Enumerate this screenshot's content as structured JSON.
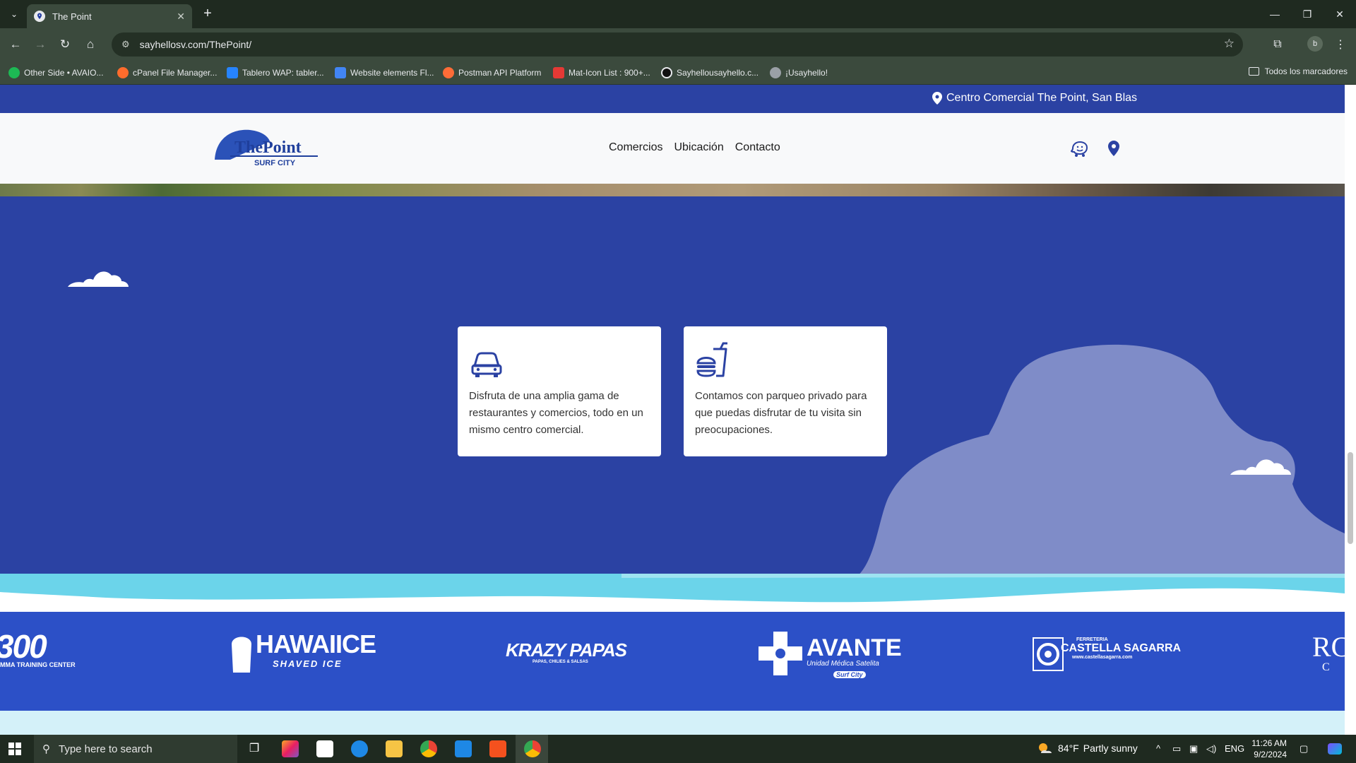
{
  "browser": {
    "tab_title": "The Point",
    "url": "sayhellosv.com/ThePoint/",
    "bookmarks": [
      {
        "label": "Other Side • AVAIO...",
        "color": "#1db954"
      },
      {
        "label": "cPanel File Manager...",
        "color": "#ff6c2c"
      },
      {
        "label": "Tablero WAP: tabler...",
        "color": "#2684ff"
      },
      {
        "label": "Website elements Fl...",
        "color": "#4285f4"
      },
      {
        "label": "Postman API Platform",
        "color": "#ff6c37"
      },
      {
        "label": "Mat-Icon List : 900+...",
        "color": "#e53935"
      },
      {
        "label": "Sayhellousayhello.c...",
        "color": "#111111"
      },
      {
        "label": "¡Usayhello!",
        "color": "#9aa0a6"
      }
    ],
    "all_bookmarks_label": "Todos los marcadores",
    "profile_initial": "b"
  },
  "site": {
    "top_location": "Centro Comercial The Point, San Blas",
    "logo_main": "ThePoint",
    "logo_sub": "SURF CITY",
    "nav": [
      "Comercios",
      "Ubicación",
      "Contacto"
    ],
    "cards": [
      {
        "icon": "car-icon",
        "text": "Disfruta de una amplia gama de restaurantes y comercios, todo en un mismo centro comercial."
      },
      {
        "icon": "fast-food-icon",
        "text": "Contamos con parqueo privado para que puedas disfrutar de tu visita sin preocupaciones."
      }
    ],
    "brands": [
      {
        "main": "300",
        "sub": "MMA TRAINING CENTER"
      },
      {
        "main": "HAWAIICE",
        "sub": "SHAVED ICE"
      },
      {
        "main": "KRAZY PAPAS",
        "sub": "PAPAS, CHILIES & SALSAS"
      },
      {
        "main": "AVANTE",
        "sub": "Unidad Médica Satelita",
        "tag": "Surf City"
      },
      {
        "main": "CASTELLA SAGARRA",
        "top": "FERRETERIA",
        "sub": "www.castellasagarra.com"
      },
      {
        "main": "RC",
        "sub": "C"
      }
    ],
    "colors": {
      "brand_blue": "#2b42a3",
      "light_cloud": "#7f8cc8",
      "wave_cyan": "#6bd4ea",
      "logo_bar": "#2c50c7"
    }
  },
  "taskbar": {
    "search_placeholder": "Type here to search",
    "weather_temp": "84°F",
    "weather_desc": "Partly sunny",
    "lang": "ENG",
    "time": "11:26 AM",
    "date": "9/2/2024"
  }
}
